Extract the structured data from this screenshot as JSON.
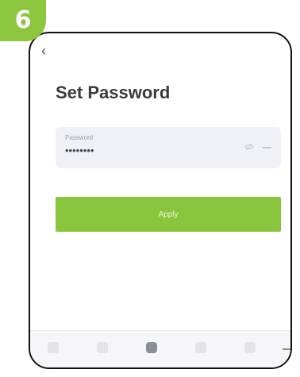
{
  "step_badge": "6",
  "nav": {
    "back_glyph": "‹"
  },
  "page": {
    "title": "Set Password"
  },
  "password_field": {
    "label": "Password",
    "value": "••••••••",
    "eye_icon": "eye-icon",
    "clear_icon": "clear-icon"
  },
  "apply_button": {
    "label": "Apply"
  },
  "bottom_nav": {
    "items": [
      "home-icon",
      "scene-icon",
      "device-icon",
      "stats-icon",
      "profile-icon"
    ],
    "active_index": 2
  },
  "colors": {
    "accent": "#8cc63f",
    "button": "#8ac53e",
    "field_bg": "#f0f1f6",
    "title": "#3b3b3b"
  }
}
